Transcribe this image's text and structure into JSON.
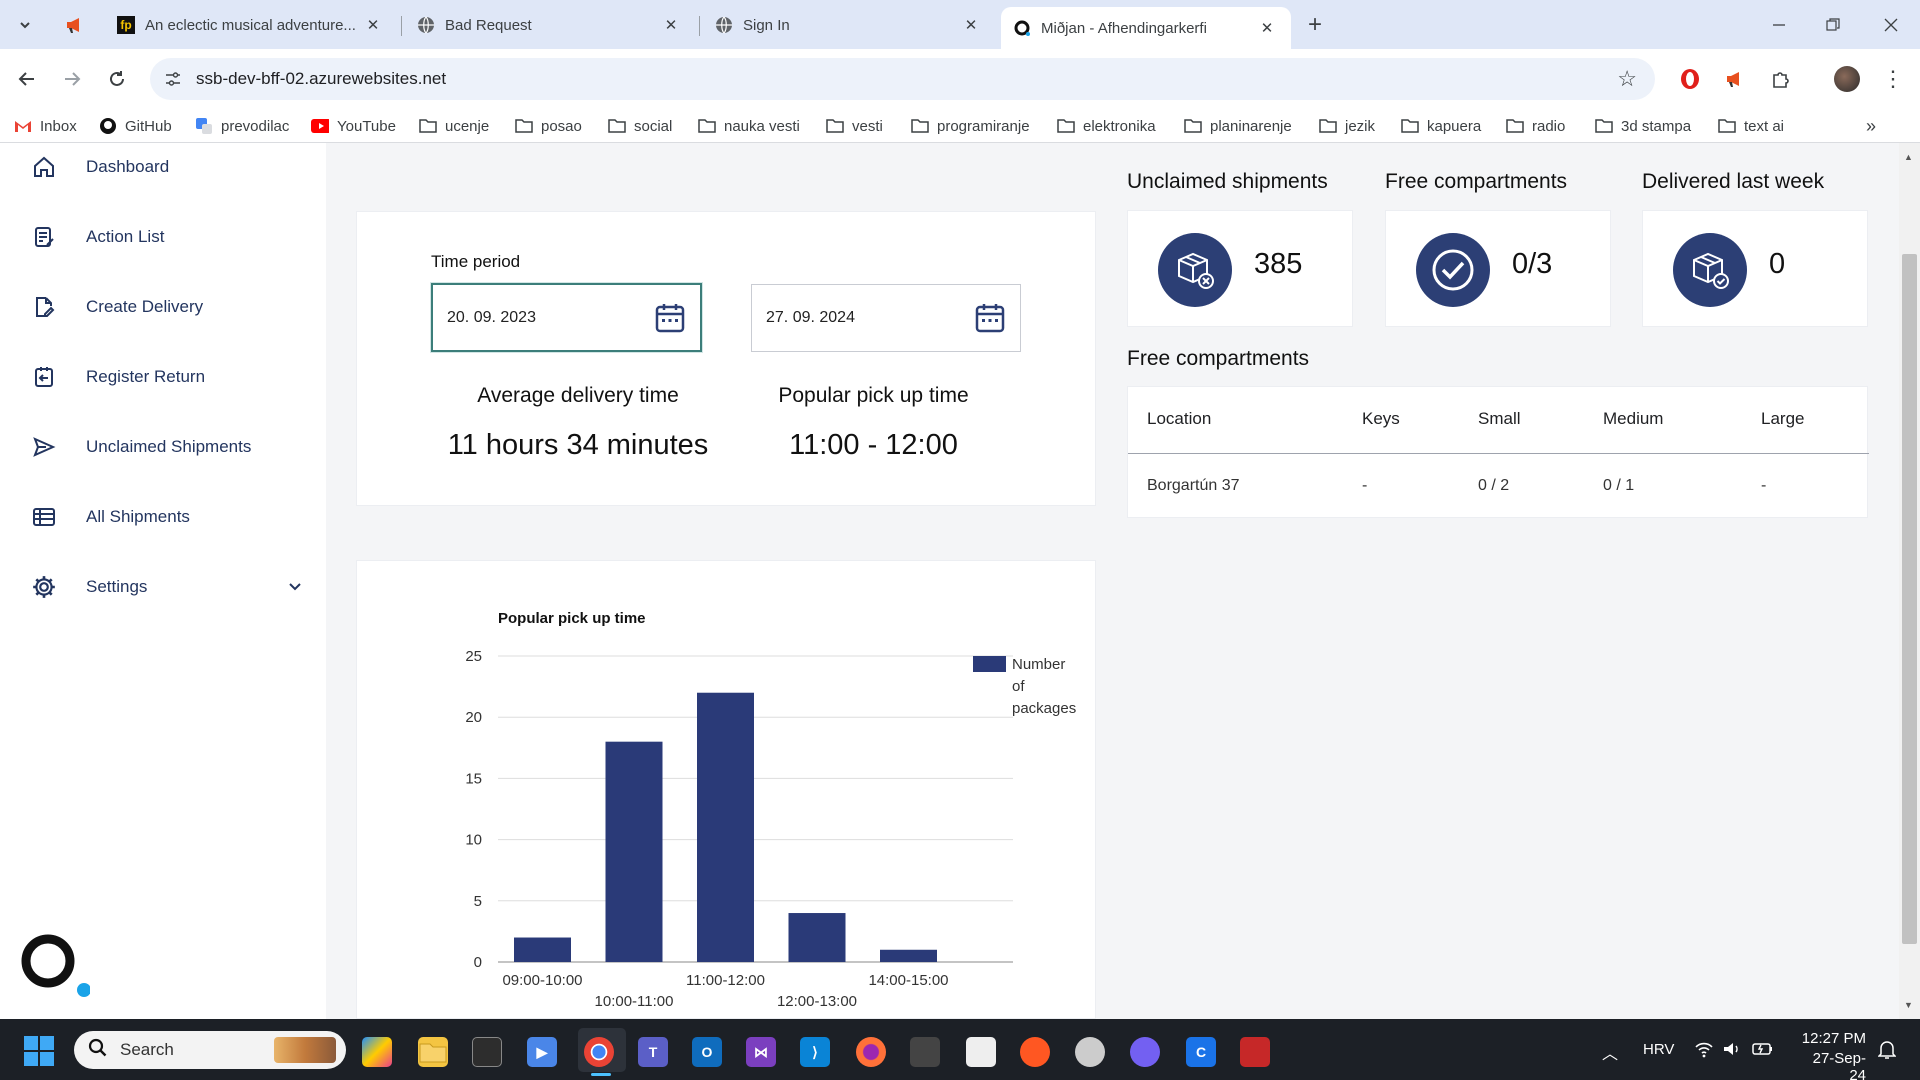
{
  "browser": {
    "tabs": [
      {
        "title": "An eclectic musical adventure...",
        "icon": "fp-icon"
      },
      {
        "title": "Bad Request",
        "icon": "globe-icon"
      },
      {
        "title": "Sign In",
        "icon": "globe-icon"
      },
      {
        "title": "Miðjan - Afhendingarkerfi",
        "icon": "site-logo-icon",
        "active": true
      }
    ],
    "url": "ssb-dev-bff-02.azurewebsites.net",
    "bookmarks": [
      "Inbox",
      "GitHub",
      "prevodilac",
      "YouTube",
      "ucenje",
      "posao",
      "social",
      "nauka vesti",
      "vesti",
      "programiranje",
      "elektronika",
      "planinarenje",
      "jezik",
      "kapuera",
      "radio",
      "3d stampa",
      "text ai"
    ]
  },
  "sidebar": {
    "items": [
      {
        "label": "Dashboard",
        "icon": "home-icon"
      },
      {
        "label": "Action List",
        "icon": "list-edit-icon"
      },
      {
        "label": "Create Delivery",
        "icon": "document-edit-icon"
      },
      {
        "label": "Register Return",
        "icon": "return-icon"
      },
      {
        "label": "Unclaimed Shipments",
        "icon": "send-icon"
      },
      {
        "label": "All Shipments",
        "icon": "table-icon"
      },
      {
        "label": "Settings",
        "icon": "gear-icon"
      }
    ]
  },
  "period": {
    "label": "Time period",
    "from": "20. 09. 2023",
    "to": "27. 09. 2024",
    "avg_title": "Average delivery time",
    "avg_value": "11 hours 34 minutes",
    "pop_title": "Popular pick up time",
    "pop_value": "11:00 - 12:00"
  },
  "stats": [
    {
      "title": "Unclaimed shipments",
      "value": "385",
      "icon": "box-x-icon"
    },
    {
      "title": "Free compartments",
      "value": "0/3",
      "icon": "check-circle-icon"
    },
    {
      "title": "Delivered last week",
      "value": "0",
      "icon": "box-check-icon"
    }
  ],
  "free_compartments": {
    "title": "Free compartments",
    "columns": [
      "Location",
      "Keys",
      "Small",
      "Medium",
      "Large"
    ],
    "rows": [
      [
        "Borgartún 37",
        "-",
        "0 / 2",
        "0 / 1",
        "-"
      ]
    ]
  },
  "chart_data": {
    "type": "bar",
    "title": "Popular pick up time",
    "categories": [
      "09:00-10:00",
      "10:00-11:00",
      "11:00-12:00",
      "12:00-13:00",
      "14:00-15:00"
    ],
    "series": [
      {
        "name": "Number of packages",
        "values": [
          2,
          18,
          22,
          4,
          1
        ],
        "color": "#2a3a78"
      }
    ],
    "ylim": [
      0,
      25
    ],
    "yticks": [
      0,
      5,
      10,
      15,
      20,
      25
    ],
    "grid": true,
    "legend": "right"
  },
  "taskbar": {
    "search_placeholder": "Search",
    "lang": "HRV",
    "time": "12:27 PM",
    "date": "27-Sep-24"
  }
}
